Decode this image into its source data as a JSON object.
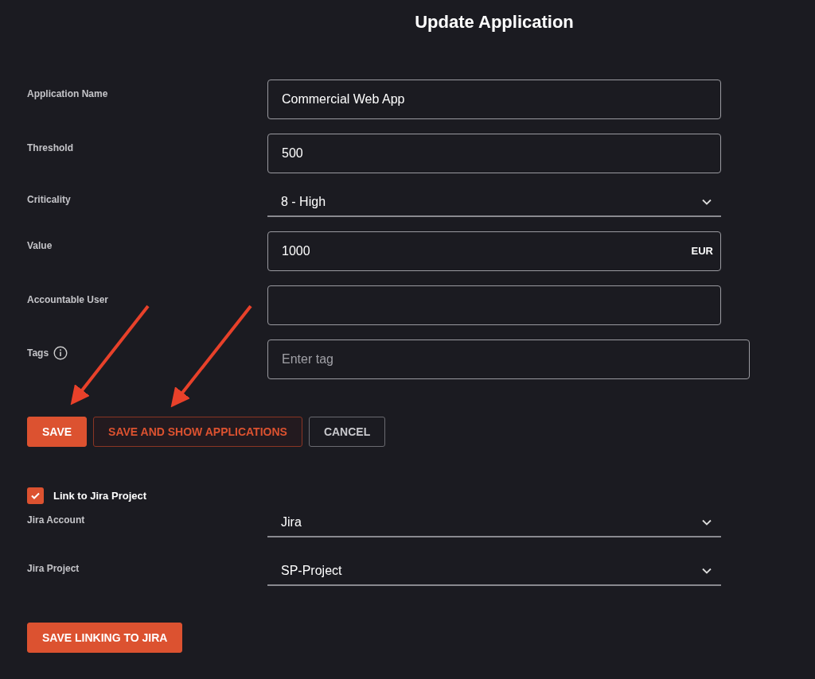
{
  "title": "Update Application",
  "fields": [
    {
      "label": "Application Name",
      "kind": "text",
      "value": "Commercial Web App"
    },
    {
      "label": "Threshold",
      "kind": "text",
      "value": "500"
    },
    {
      "label": "Criticality",
      "kind": "select",
      "value": "8 - High"
    },
    {
      "label": "Value",
      "kind": "currency",
      "value": "1000",
      "suffix": "EUR"
    },
    {
      "label": "Accountable User",
      "kind": "text"
    },
    {
      "label": "Tags",
      "kind": "tags",
      "placeholder": "Enter tag",
      "info": true
    }
  ],
  "buttons": [
    {
      "label": "SAVE",
      "kind": "primary"
    },
    {
      "label": "SAVE AND SHOW APPLICATIONS",
      "kind": "outline"
    },
    {
      "label": "CANCEL",
      "kind": "secondary"
    }
  ],
  "jira": {
    "link": {
      "label": "Link to Jira Project",
      "checked": true
    },
    "fields": [
      {
        "label": "Jira Account",
        "kind": "select",
        "value": "Jira"
      },
      {
        "label": "Jira Project",
        "kind": "select",
        "value": "SP-Project"
      }
    ],
    "button": {
      "label": "SAVE LINKING TO JIRA",
      "kind": "primary"
    }
  }
}
